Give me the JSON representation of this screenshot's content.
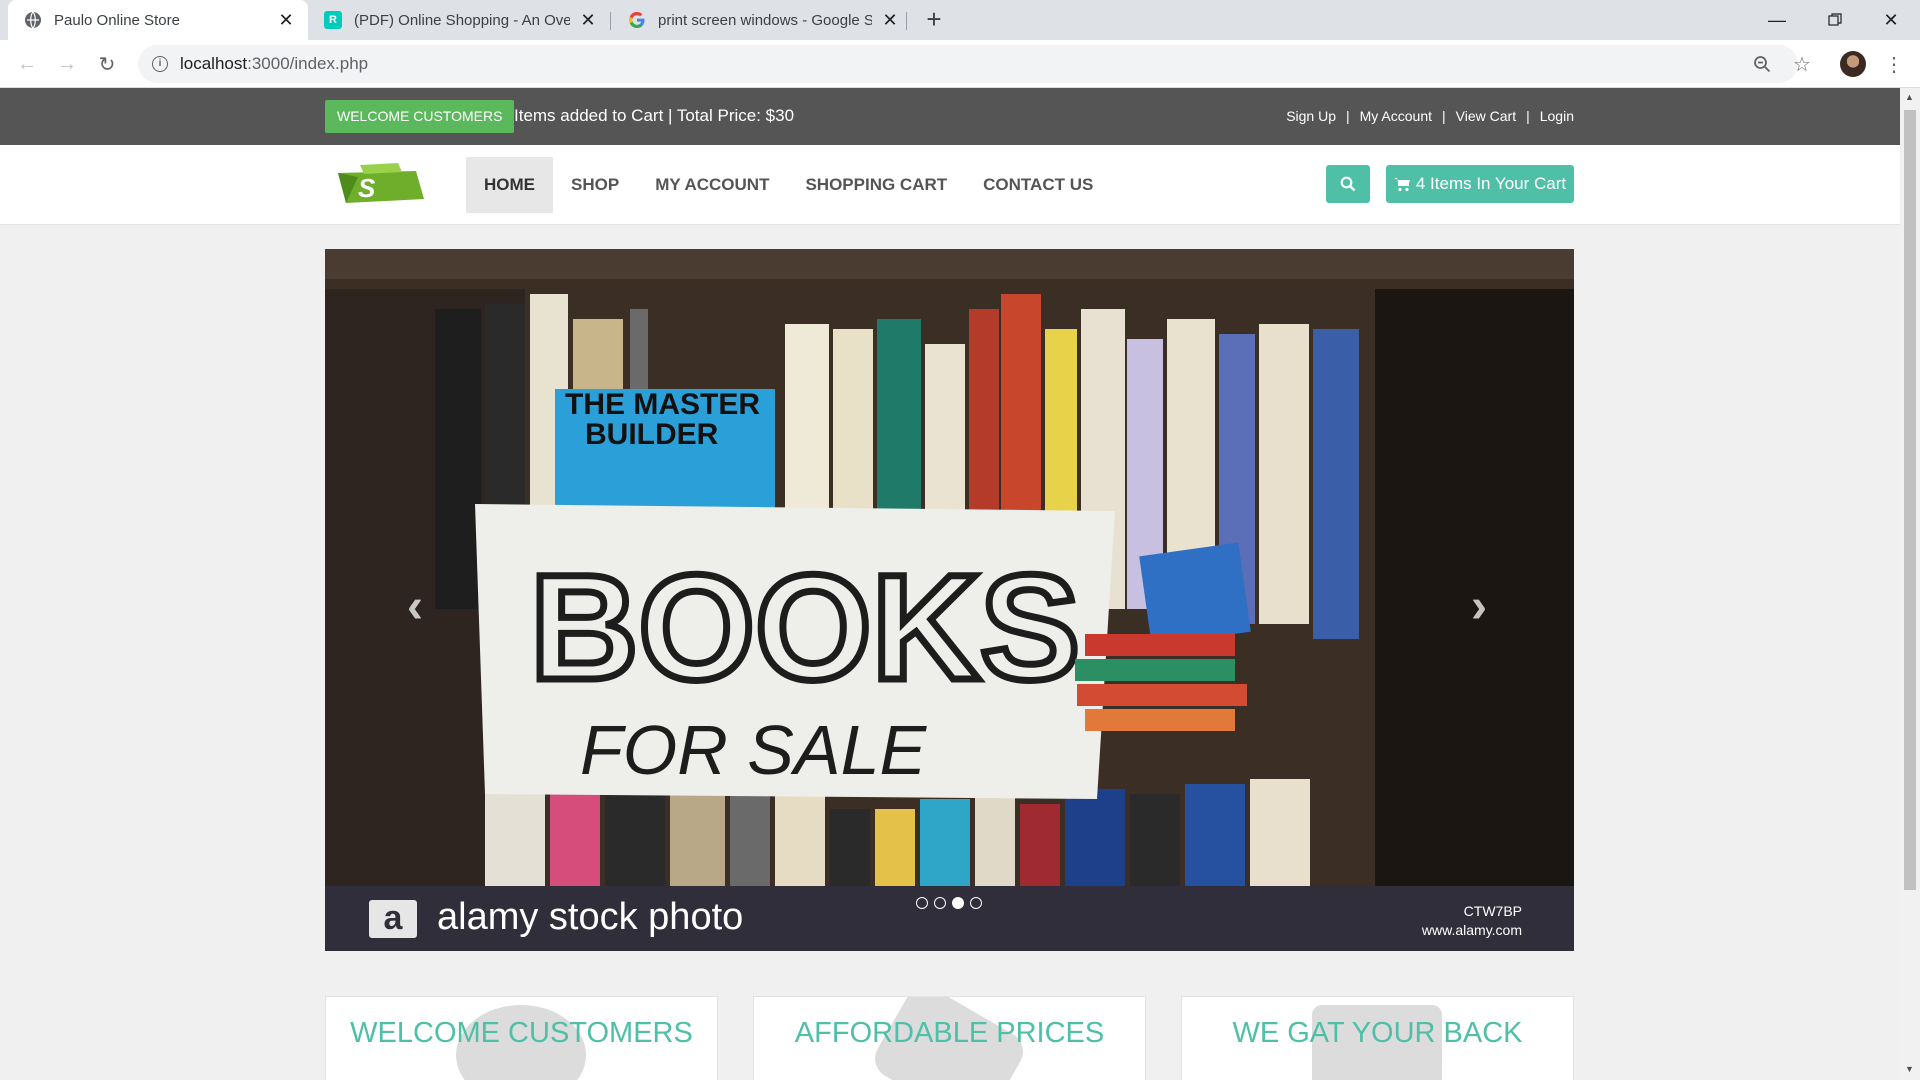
{
  "browser": {
    "tabs": [
      {
        "title": "Paulo Online Store",
        "favicon": "globe-icon",
        "active": true
      },
      {
        "title": "(PDF) Online Shopping - An Over",
        "favicon": "researchgate-icon",
        "active": false
      },
      {
        "title": "print screen windows - Google S",
        "favicon": "google-icon",
        "active": false
      }
    ],
    "new_tab_label": "+",
    "url_host": "localhost",
    "url_rest": ":3000/index.php"
  },
  "topbar": {
    "welcome_label": "WELCOME CUSTOMERS",
    "cart_info": "Items added to Cart | Total Price: $30",
    "links": [
      "Sign Up",
      "My Account",
      "View Cart",
      "Login"
    ]
  },
  "nav": {
    "items": [
      "HOME",
      "SHOP",
      "MY ACCOUNT",
      "SHOPPING CART",
      "CONTACT US"
    ],
    "active": "HOME",
    "cart_button": "4 Items In Your Cart"
  },
  "carousel": {
    "image_description": "bookshelf with BOOKS FOR SALE sign",
    "watermark": "alamy stock photo",
    "stock_id": "CTW7BP",
    "stock_site": "www.alamy.com",
    "slides": 4,
    "active_slide": 3
  },
  "features": [
    {
      "title": "WELCOME CUSTOMERS"
    },
    {
      "title": "AFFORDABLE PRICES"
    },
    {
      "title": "WE GAT YOUR BACK"
    }
  ],
  "colors": {
    "accent": "#4fbfa8",
    "topbar": "#555555",
    "welcome_green": "#5cb85c"
  }
}
